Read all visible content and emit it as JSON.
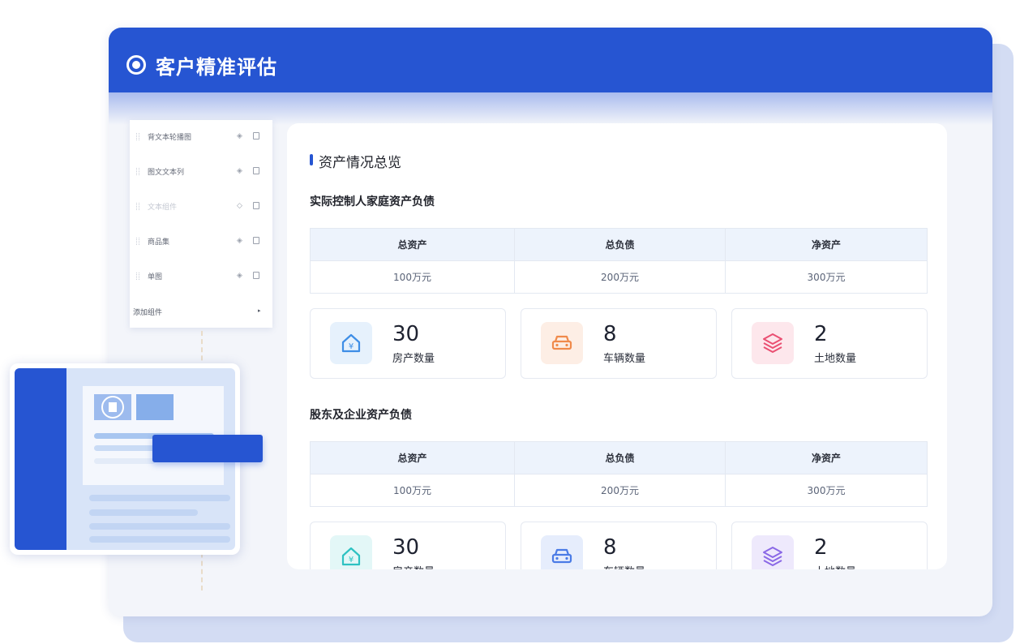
{
  "window": {
    "title": "客户精准评估"
  },
  "components": {
    "items": [
      {
        "label": "背文本轮播图",
        "enabled": true
      },
      {
        "label": "图文文本列",
        "enabled": true
      },
      {
        "label": "文本组件",
        "enabled": false
      },
      {
        "label": "商品集",
        "enabled": true
      },
      {
        "label": "单图",
        "enabled": true
      }
    ],
    "add_label": "添加组件"
  },
  "overview": {
    "title": "资产情况总览",
    "sections": [
      {
        "title": "实际控制人家庭资产负债",
        "headers": [
          "总资产",
          "总负债",
          "净资产"
        ],
        "values": [
          "100万元",
          "200万元",
          "300万元"
        ],
        "stats": [
          {
            "value": "30",
            "label": "房产数量",
            "icon": "house-icon",
            "color": "#3e8ee6",
            "bg": "#e6f1fc"
          },
          {
            "value": "8",
            "label": "车辆数量",
            "icon": "car-icon",
            "color": "#f08a4b",
            "bg": "#fdeee5"
          },
          {
            "value": "2",
            "label": "土地数量",
            "icon": "layers-icon",
            "color": "#ea4f72",
            "bg": "#fde7ec"
          }
        ]
      },
      {
        "title": "股东及企业资产负债",
        "headers": [
          "总资产",
          "总负债",
          "净资产"
        ],
        "values": [
          "100万元",
          "200万元",
          "300万元"
        ],
        "stats": [
          {
            "value": "30",
            "label": "房产数量",
            "icon": "house-icon",
            "color": "#2ec2c2",
            "bg": "#e3f7f7"
          },
          {
            "value": "8",
            "label": "车辆数量",
            "icon": "car-icon",
            "color": "#4a7be6",
            "bg": "#e6edfc"
          },
          {
            "value": "2",
            "label": "土地数量",
            "icon": "layers-icon",
            "color": "#8a68e6",
            "bg": "#eee9fc"
          }
        ]
      }
    ]
  }
}
